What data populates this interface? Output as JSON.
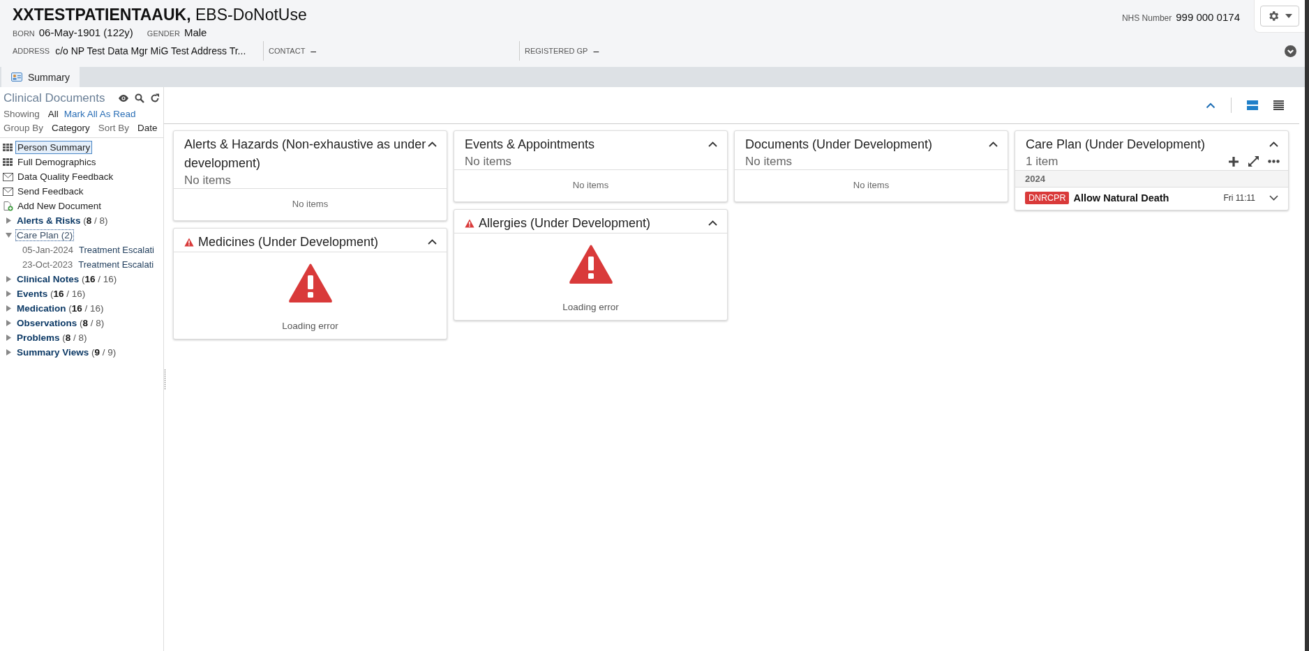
{
  "header": {
    "surname": "XXTESTPATIENTAAUK,",
    "given": "EBS-DoNotUse",
    "born_label": "BORN",
    "born": "06-May-1901 (122y)",
    "gender_label": "GENDER",
    "gender": "Male",
    "nhs_label": "NHS Number",
    "nhs": "999 000 0174",
    "fields": [
      {
        "label": "ADDRESS",
        "value": "c/o NP Test Data Mgr MiG Test Address Tr..."
      },
      {
        "label": "CONTACT",
        "value": "–"
      },
      {
        "label": "REGISTERED GP",
        "value": "–"
      }
    ]
  },
  "tabs": [
    {
      "label": "Summary",
      "selected": true
    }
  ],
  "sidebar": {
    "title": "Clinical Documents",
    "showing_label": "Showing",
    "showing_value": "All",
    "mark_all": "Mark All As Read",
    "group_by_label": "Group By",
    "group_by_value": "Category",
    "sort_by_label": "Sort By",
    "sort_by_value": "Date",
    "links": [
      {
        "kind": "grid",
        "label": "Person Summary",
        "selected": true
      },
      {
        "kind": "grid",
        "label": "Full Demographics",
        "selected": false
      },
      {
        "kind": "mail",
        "label": "Data Quality Feedback",
        "selected": false
      },
      {
        "kind": "mail",
        "label": "Send Feedback",
        "selected": false
      },
      {
        "kind": "add",
        "label": "Add New Document",
        "selected": false
      }
    ],
    "tree": [
      {
        "kind": "category",
        "label": "Alerts & Risks",
        "count": "(**8** / 8)",
        "expanded": false,
        "selected": false
      },
      {
        "kind": "plain",
        "label": "Care Plan (2)",
        "expanded": true,
        "selected": true,
        "children": [
          {
            "date": "05-Jan-2024",
            "title": "Treatment Escalati"
          },
          {
            "date": "23-Oct-2023",
            "title": "Treatment Escalati"
          }
        ]
      },
      {
        "kind": "category",
        "label": "Clinical Notes",
        "count": "(**16** / 16)",
        "expanded": false,
        "selected": false
      },
      {
        "kind": "category",
        "label": "Events",
        "count": "(**16** / 16)",
        "expanded": false,
        "selected": false
      },
      {
        "kind": "category",
        "label": "Medication",
        "count": "(**16** / 16)",
        "expanded": false,
        "selected": false
      },
      {
        "kind": "category",
        "label": "Observations",
        "count": "(**8** / 8)",
        "expanded": false,
        "selected": false
      },
      {
        "kind": "category",
        "label": "Problems",
        "count": "(**8** / 8)",
        "expanded": false,
        "selected": false
      },
      {
        "kind": "category",
        "label": "Summary Views",
        "count": "(**9** / 9)",
        "expanded": false,
        "selected": false
      }
    ]
  },
  "toolbar": {
    "views": [
      {
        "kind": "tiles",
        "selected": true
      },
      {
        "kind": "list",
        "selected": false
      }
    ]
  },
  "columns": [
    [
      {
        "kind": "empty",
        "title": "Alerts & Hazards (Non-exhaustive as under development)",
        "warning": false,
        "subtitle": "No items",
        "message": "No items"
      },
      {
        "kind": "error",
        "title": "Medicines (Under Development)",
        "warning": true,
        "message": "Loading error"
      }
    ],
    [
      {
        "kind": "empty",
        "title": "Events & Appointments",
        "warning": false,
        "subtitle": "No items",
        "message": "No items"
      },
      {
        "kind": "error",
        "title": "Allergies (Under Development)",
        "warning": true,
        "message": "Loading error"
      }
    ],
    [
      {
        "kind": "empty",
        "title": "Documents (Under Development)",
        "warning": false,
        "subtitle": "No items",
        "message": "No items"
      }
    ],
    [
      {
        "kind": "list",
        "title": "Care Plan (Under Development)",
        "warning": false,
        "subtitle": "1 item",
        "group": "2024",
        "rows": [
          {
            "tag": "DNRCPR",
            "title": "Allow Natural Death",
            "time": "Fri 11:11"
          }
        ]
      }
    ]
  ]
}
